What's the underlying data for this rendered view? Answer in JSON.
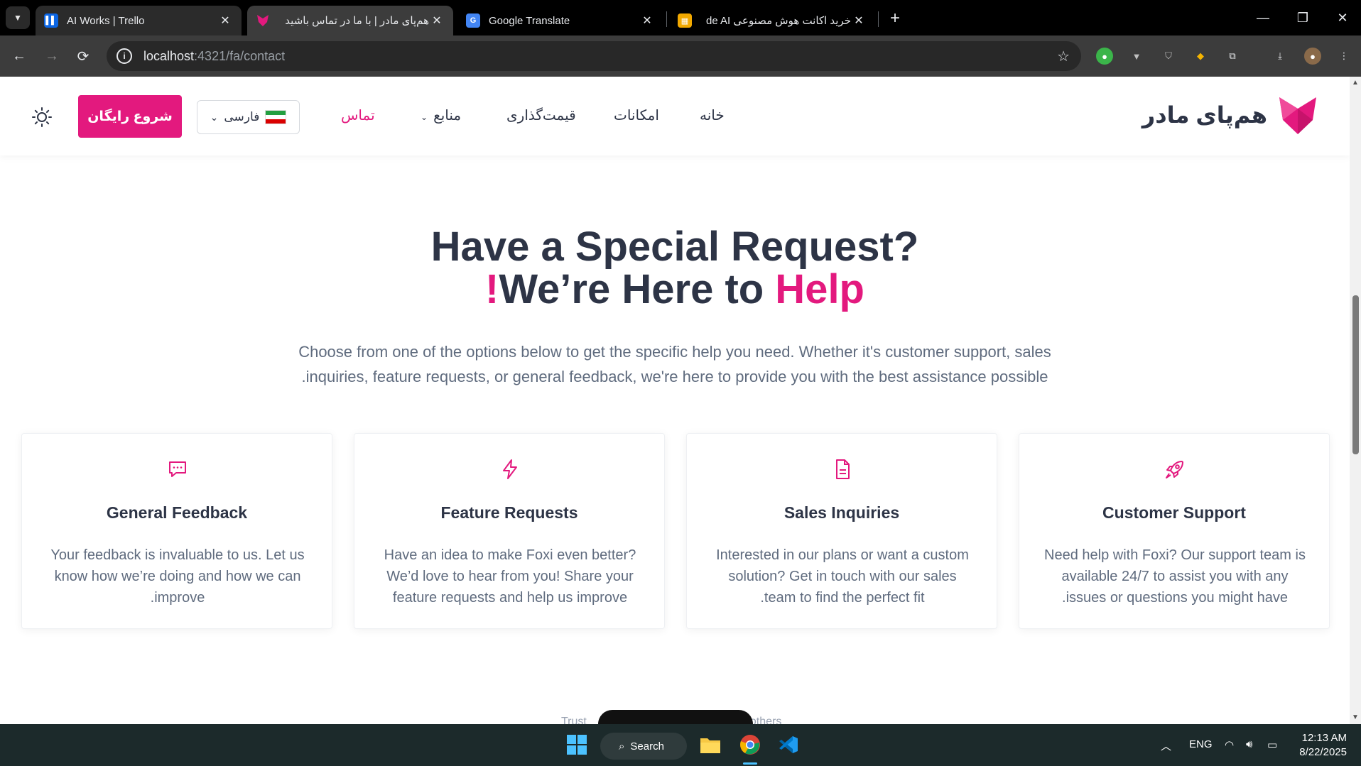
{
  "browser": {
    "tabs": [
      {
        "title": "AI Works | Trello",
        "favicon": "trello-icon"
      },
      {
        "title": "هم‌پای مادر | با ما در تماس باشید",
        "favicon": "fox-icon",
        "active": true
      },
      {
        "title": "Google Translate",
        "favicon": "translate-icon"
      },
      {
        "title": "خرید اکانت هوش مصنوعی de AI",
        "favicon": "grid-icon"
      }
    ],
    "url_host": "localhost",
    "url_path": ":4321/fa/contact"
  },
  "nav": {
    "brand": "هم‌پای مادر",
    "links": {
      "home": "خانه",
      "features": "امکانات",
      "pricing": "قیمت‌گذاری",
      "resources": "منابع",
      "contact": "تماس"
    },
    "language": "فارسی",
    "cta": "شروع رایگان",
    "accent_color": "#e3197e"
  },
  "hero": {
    "title_line1": "Have a Special Request?",
    "title_line2_mark": "!",
    "title_line2_text": "We’re Here to ",
    "title_line2_accent": "Help",
    "subtitle_line1": "Choose from one of the options below to get the specific help you need. Whether it's customer support, sales",
    "subtitle_line2": ".inquiries, feature requests, or general feedback, we're here to provide you with the best assistance possible"
  },
  "cards": [
    {
      "icon": "chat-icon",
      "title": "General Feedback",
      "lines": [
        "Your feedback is invaluable to us. Let us",
        "know how we’re doing and how we can",
        ".improve"
      ]
    },
    {
      "icon": "bolt-icon",
      "title": "Feature Requests",
      "lines": [
        "Have an idea to make Foxi even better?",
        "We’d love to hear from you! Share your",
        "feature requests and help us improve"
      ]
    },
    {
      "icon": "document-icon",
      "title": "Sales Inquiries",
      "lines": [
        "Interested in our plans or want a custom",
        "solution? Get in touch with our sales",
        ".team to find the perfect fit"
      ]
    },
    {
      "icon": "rocket-icon",
      "title": "Customer Support",
      "lines": [
        "Need help with Foxi? Our support team is",
        "available 24/7 to assist you with any",
        ".issues or questions you might have"
      ]
    }
  ],
  "partial_text": {
    "left": "Trust",
    "right": "others"
  },
  "taskbar": {
    "search": "Search",
    "language": "ENG",
    "time": "12:13 AM",
    "date": "8/22/2025"
  }
}
